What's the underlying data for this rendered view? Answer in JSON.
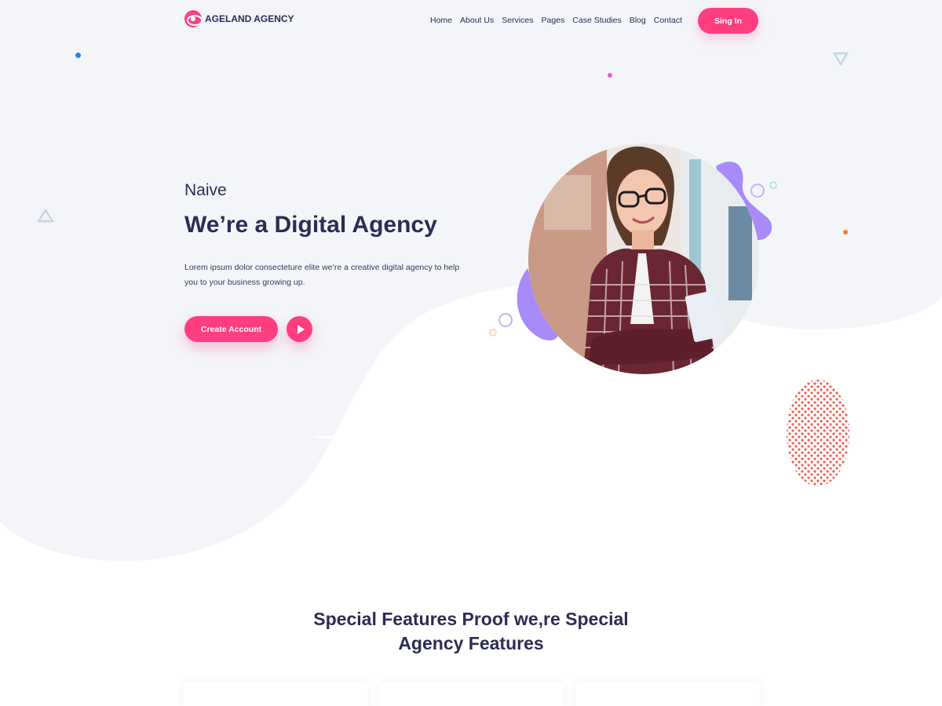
{
  "brand": {
    "name": "AGELAND AGENCY"
  },
  "nav": {
    "items": [
      "Home",
      "About Us",
      "Services",
      "Pages",
      "Case Studies",
      "Blog",
      "Contact"
    ],
    "signin_label": "Sing In"
  },
  "hero": {
    "pretitle": "Naive",
    "title": "We’re a Digital Agency",
    "description": "Lorem ipsum dolor consecteture elite we’re a creative digital agency to help you to your business growing up.",
    "cta_label": "Create Account"
  },
  "features": {
    "title_line1": "Special Features Proof we,re Special",
    "title_line2_plain": "Agency ",
    "title_line2_bold": "Features"
  },
  "colors": {
    "accent": "#ff3e7f",
    "text": "#2c2c54",
    "background": "#f5f6fa",
    "purple": "#a88bf8"
  },
  "icons": [
    "logo-icon",
    "play-icon",
    "triangle-icon",
    "dot-pattern"
  ]
}
